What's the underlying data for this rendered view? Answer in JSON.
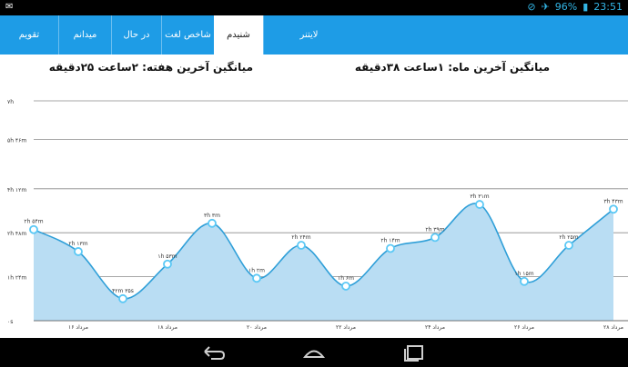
{
  "status_bar": {
    "notification_icon": "android-notification-icon",
    "battery_text": "96%",
    "time": "23:51"
  },
  "tabs": [
    {
      "label": "لایتنر",
      "active": false
    },
    {
      "label": "شنیدم",
      "active": true
    },
    {
      "label": "شاخص لغت",
      "active": false
    },
    {
      "label": "در حال یادگیری",
      "active": false
    },
    {
      "label": "میدانم",
      "active": false
    },
    {
      "label": "تقویم",
      "active": false
    }
  ],
  "stats": {
    "month_avg": "میانگین آخرین ماه: ۱ساعت ۳۸دقیقه",
    "week_avg": "میانگین آخرین هفته: ۲ساعت ۲۵دقیقه"
  },
  "chart_data": {
    "type": "area",
    "y_ticks": [
      {
        "label": "۷h",
        "value": 7
      },
      {
        "label": "۵h ۴۶m",
        "value": 5.77
      },
      {
        "label": "۴h ۱۲m",
        "value": 4.2
      },
      {
        "label": "۲h ۴۸m",
        "value": 2.8
      },
      {
        "label": "۱h ۲۴m",
        "value": 1.4
      },
      {
        "label": "۰s",
        "value": 0
      }
    ],
    "ylim": [
      0,
      7
    ],
    "x_tick_labels": [
      "۱۶ مرداد",
      "۱۸ مرداد",
      "۲۰ مرداد",
      "۲۲ مرداد",
      "۲۴ مرداد",
      "۲۶ مرداد",
      "۲۸ مرداد"
    ],
    "x": [
      "۱۵",
      "۱۶",
      "۱۷",
      "۱۸",
      "۱۹",
      "۲۰",
      "۲۱",
      "۲۲",
      "۲۳",
      "۲۴",
      "۲۵",
      "۲۶",
      "۲۷",
      "۲۸"
    ],
    "values": [
      2.9,
      2.2,
      0.7,
      1.8,
      3.1,
      1.35,
      2.4,
      1.1,
      2.3,
      2.65,
      3.7,
      1.25,
      2.4,
      3.55
    ],
    "point_labels": [
      "۲h ۵۴m",
      "۲h ۱۳m",
      "۴۲m ۳۵s",
      "۱h ۵۳m",
      "۳h ۳m",
      "۱h ۲m",
      "۲h ۲۴m",
      "۱h ۶m",
      "۲h ۱۴m",
      "۲h ۳۹m",
      "۳h ۳۱m",
      "۱h ۱۵m",
      "۲h ۲۵m",
      "۳h ۴۳m"
    ],
    "colors": {
      "fill": "#b9ddf3",
      "line": "#2f9fd8",
      "point": "#5ac8f5",
      "grid": "#8a8a8a"
    }
  },
  "nav": {
    "back_icon": "back-icon",
    "home_icon": "home-icon",
    "recents_icon": "recents-icon"
  }
}
